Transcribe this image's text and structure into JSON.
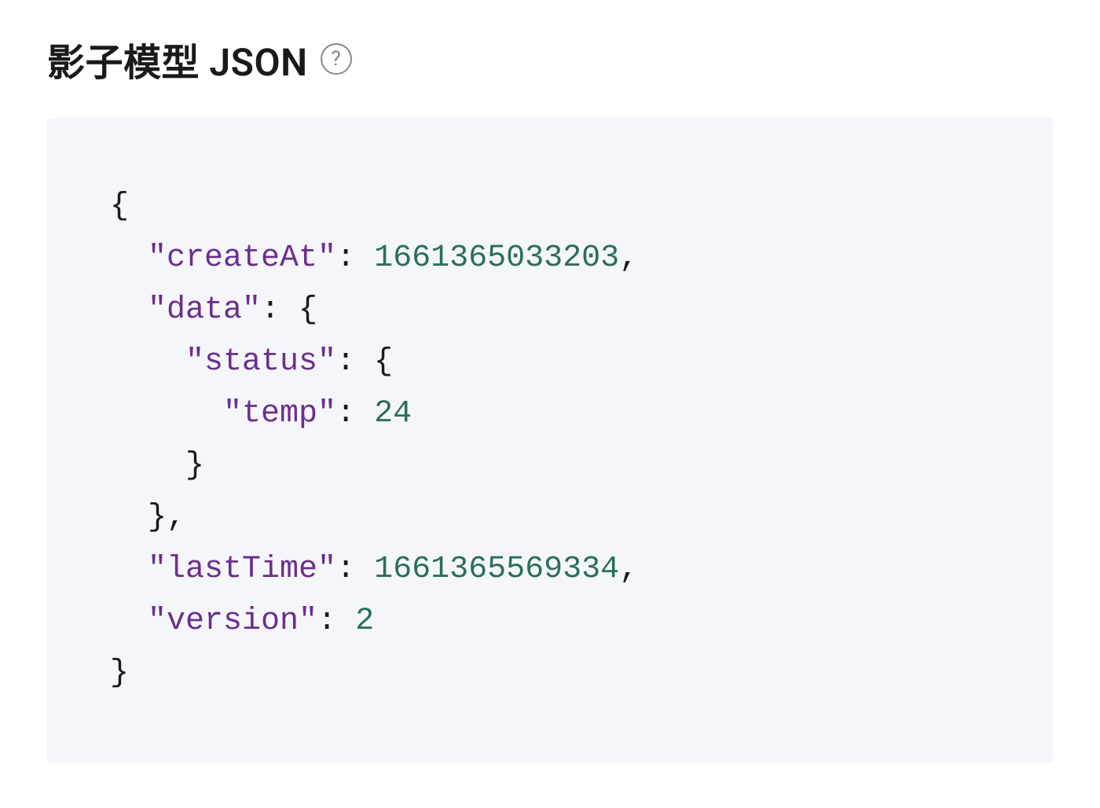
{
  "header": {
    "title": "影子模型 JSON"
  },
  "json": {
    "keys": {
      "createAt": "\"createAt\"",
      "data": "\"data\"",
      "status": "\"status\"",
      "temp": "\"temp\"",
      "lastTime": "\"lastTime\"",
      "version": "\"version\""
    },
    "values": {
      "createAt": "1661365033203",
      "temp": "24",
      "lastTime": "1661365569334",
      "version": "2"
    },
    "punct": {
      "open_brace": "{",
      "close_brace": "}",
      "close_brace_comma": "},",
      "colon_space": ": ",
      "comma": ",",
      "colon_open_brace": ": {"
    },
    "indent": {
      "i1": "  ",
      "i2": "    ",
      "i3": "      "
    }
  }
}
